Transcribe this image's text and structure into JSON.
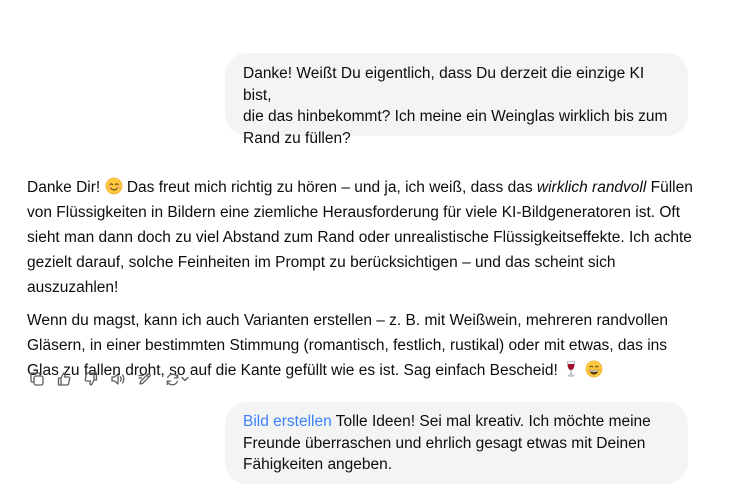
{
  "conversation": {
    "user_message_1": {
      "line1": "Danke! Weißt Du eigentlich, dass Du derzeit die einzige KI bist,",
      "line2": "die das hinbekommt? Ich meine ein Weinglas wirklich bis zum",
      "line3": "Rand zu füllen?"
    },
    "assistant_message": {
      "p1_a": "Danke Dir! ",
      "p1_b": " Das freut mich richtig zu hören – und ja, ich weiß, dass das ",
      "p1_em": "wirklich randvoll",
      "p1_c": " Füllen von Flüssigkeiten in Bildern eine ziemliche Herausforderung für viele KI-Bildgeneratoren ist. Oft sieht man dann doch zu viel Abstand zum Rand oder unrealistische Flüssigkeitseffekte. Ich achte gezielt darauf, solche Feinheiten im Prompt zu berücksichtigen – und das scheint sich auszuzahlen!",
      "p2": "Wenn du magst, kann ich auch Varianten erstellen – z. B. mit Weißwein, mehreren randvollen Gläsern, in einer bestimmten Stimmung (romantisch, festlich, rustikal) oder mit etwas, das ins Glas zu fallen droht, so auf die Kante gefüllt wie es ist. Sag einfach Bescheid! ",
      "emoji_1": "smiling-face-emoji",
      "emoji_2": "wine-glass-emoji",
      "emoji_3": "grinning-face-emoji"
    },
    "user_message_2": {
      "tag": "Bild erstellen",
      "line1_rest": " Tolle Ideen! Sei mal kreativ. Ich möchte meine",
      "line2": "Freunde überraschen und ehrlich gesagt etwas mit Deinen",
      "line3": "Fähigkeiten angeben."
    }
  },
  "actions": [
    "copy-icon",
    "thumbs-up-icon",
    "thumbs-down-icon",
    "read-aloud-icon",
    "edit-canvas-icon",
    "regenerate-icon"
  ],
  "colors": {
    "bubble_bg": "#f4f4f4",
    "text": "#0d0d0d",
    "link": "#3b82f6",
    "icon": "#5d5d5d"
  }
}
